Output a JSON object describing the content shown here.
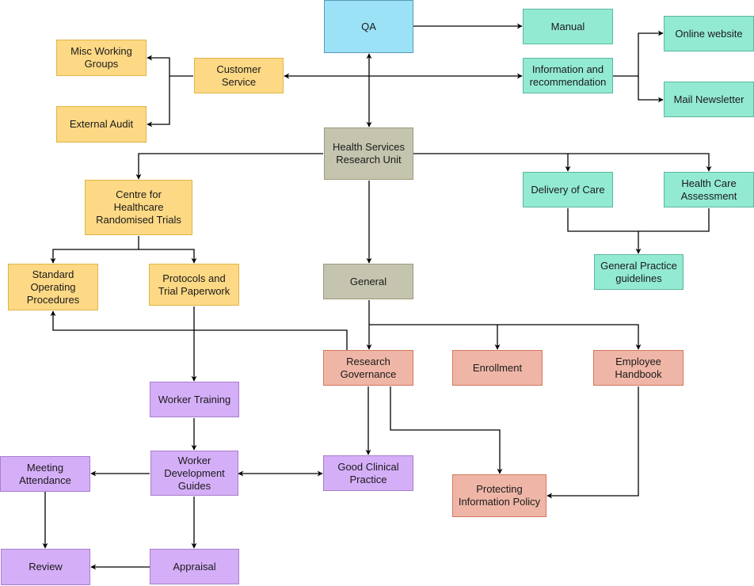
{
  "diagram": {
    "type": "organizational flowchart",
    "palette": {
      "yellow": "#fdd985",
      "blue": "#9ce2f7",
      "teal": "#93ead3",
      "olive": "#c5c4af",
      "red": "#efb6a7",
      "purple": "#d5aef8",
      "edge": "#000000"
    },
    "nodes": {
      "qa": {
        "label": "QA",
        "color": "blue"
      },
      "manual": {
        "label": "Manual",
        "color": "teal"
      },
      "info": {
        "label": "Information and\nrecommendation",
        "color": "teal"
      },
      "online": {
        "label": "Online website",
        "color": "teal"
      },
      "mail": {
        "label": "Mail Newsletter",
        "color": "teal"
      },
      "customer": {
        "label": "Customer\nService",
        "color": "yellow"
      },
      "misc": {
        "label": "Misc Working\nGroups",
        "color": "yellow"
      },
      "audit": {
        "label": "External Audit",
        "color": "yellow"
      },
      "hsru": {
        "label": "Health Services\nResearch Unit",
        "color": "olive"
      },
      "chrt": {
        "label": "Centre for\nHealthcare\nRandomised Trials",
        "color": "yellow"
      },
      "sop": {
        "label": "Standard\nOperating\nProcedures",
        "color": "yellow"
      },
      "protocols": {
        "label": "Protocols and\nTrial Paperwork",
        "color": "yellow"
      },
      "delivery": {
        "label": "Delivery of Care",
        "color": "teal"
      },
      "hca": {
        "label": "Health Care\nAssessment",
        "color": "teal"
      },
      "gpg": {
        "label": "General Practice\nguidelines",
        "color": "teal"
      },
      "general": {
        "label": "General",
        "color": "olive"
      },
      "rg": {
        "label": "Research\nGovernance",
        "color": "red"
      },
      "enrollment": {
        "label": "Enrollment",
        "color": "red"
      },
      "handbook": {
        "label": "Employee\nHandbook",
        "color": "red"
      },
      "training": {
        "label": "Worker Training",
        "color": "purple"
      },
      "guides": {
        "label": "Worker\nDevelopment\nGuides",
        "color": "purple"
      },
      "gcp": {
        "label": "Good Clinical\nPractice",
        "color": "purple"
      },
      "pip": {
        "label": "Protecting\nInformation Policy",
        "color": "red"
      },
      "meeting": {
        "label": "Meeting\nAttendance",
        "color": "purple"
      },
      "review": {
        "label": "Review",
        "color": "purple"
      },
      "appraisal": {
        "label": "Appraisal",
        "color": "purple"
      }
    },
    "edges": [
      {
        "from": "qa",
        "to": "manual",
        "direction": "forward"
      },
      {
        "from": "qa",
        "to": "hsru",
        "direction": "both"
      },
      {
        "from": "customer",
        "to": "info",
        "direction": "both"
      },
      {
        "from": "customer",
        "to": "misc",
        "direction": "forward"
      },
      {
        "from": "customer",
        "to": "audit",
        "direction": "forward"
      },
      {
        "from": "info",
        "to": "online",
        "direction": "forward"
      },
      {
        "from": "info",
        "to": "mail",
        "direction": "forward"
      },
      {
        "from": "hsru",
        "to": "chrt",
        "direction": "forward"
      },
      {
        "from": "hsru",
        "to": "delivery",
        "direction": "forward"
      },
      {
        "from": "hsru",
        "to": "hca",
        "direction": "forward"
      },
      {
        "from": "hsru",
        "to": "general",
        "direction": "forward"
      },
      {
        "from": "chrt",
        "to": "sop",
        "direction": "forward"
      },
      {
        "from": "chrt",
        "to": "protocols",
        "direction": "forward"
      },
      {
        "from": "delivery",
        "to": "gpg",
        "direction": "forward"
      },
      {
        "from": "hca",
        "to": "gpg",
        "direction": "forward"
      },
      {
        "from": "general",
        "to": "rg",
        "direction": "forward"
      },
      {
        "from": "general",
        "to": "enrollment",
        "direction": "forward"
      },
      {
        "from": "general",
        "to": "handbook",
        "direction": "forward"
      },
      {
        "from": "rg",
        "to": "sop",
        "direction": "forward"
      },
      {
        "from": "rg",
        "to": "gcp",
        "direction": "forward"
      },
      {
        "from": "rg",
        "to": "pip",
        "direction": "forward"
      },
      {
        "from": "handbook",
        "to": "pip",
        "direction": "forward"
      },
      {
        "from": "protocols",
        "to": "training",
        "direction": "forward"
      },
      {
        "from": "training",
        "to": "guides",
        "direction": "forward"
      },
      {
        "from": "guides",
        "to": "gcp",
        "direction": "both"
      },
      {
        "from": "guides",
        "to": "meeting",
        "direction": "forward"
      },
      {
        "from": "guides",
        "to": "appraisal",
        "direction": "forward"
      },
      {
        "from": "meeting",
        "to": "review",
        "direction": "forward"
      },
      {
        "from": "appraisal",
        "to": "review",
        "direction": "forward"
      }
    ]
  }
}
